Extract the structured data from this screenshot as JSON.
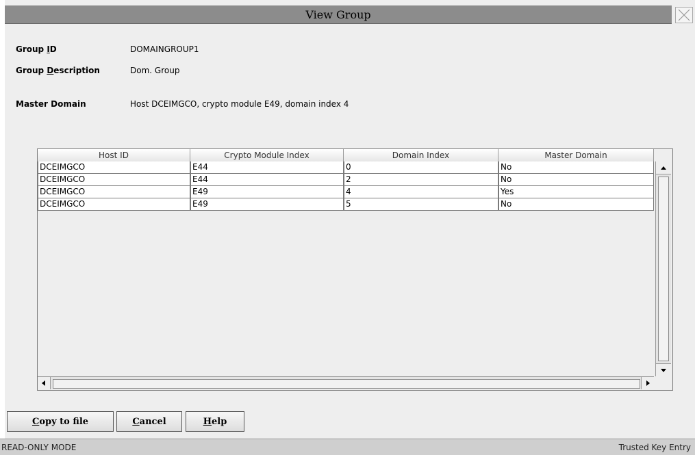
{
  "window": {
    "title": "View Group"
  },
  "fields": {
    "group_id": {
      "label_pre": "Group ",
      "label_key": "I",
      "label_post": "D",
      "value": "DOMAINGROUP1"
    },
    "group_description": {
      "label_pre": "Group ",
      "label_key": "D",
      "label_post": "escription",
      "value": "Dom. Group"
    },
    "master_domain": {
      "label": "Master Domain",
      "value": "Host DCEIMGCO, crypto module E49, domain index 4"
    }
  },
  "table": {
    "columns": [
      "Host ID",
      "Crypto Module Index",
      "Domain Index",
      "Master Domain"
    ],
    "rows": [
      [
        "DCEIMGCO",
        "E44",
        "0",
        "No"
      ],
      [
        "DCEIMGCO",
        "E44",
        "2",
        "No"
      ],
      [
        "DCEIMGCO",
        "E49",
        "4",
        "Yes"
      ],
      [
        "DCEIMGCO",
        "E49",
        "5",
        "No"
      ]
    ]
  },
  "buttons": {
    "copy": {
      "key": "C",
      "rest": "opy to file"
    },
    "cancel": {
      "key": "C",
      "rest": "ancel"
    },
    "help": {
      "key": "H",
      "rest": "elp"
    }
  },
  "status": {
    "left": "READ-ONLY MODE",
    "right": "Trusted Key Entry"
  }
}
